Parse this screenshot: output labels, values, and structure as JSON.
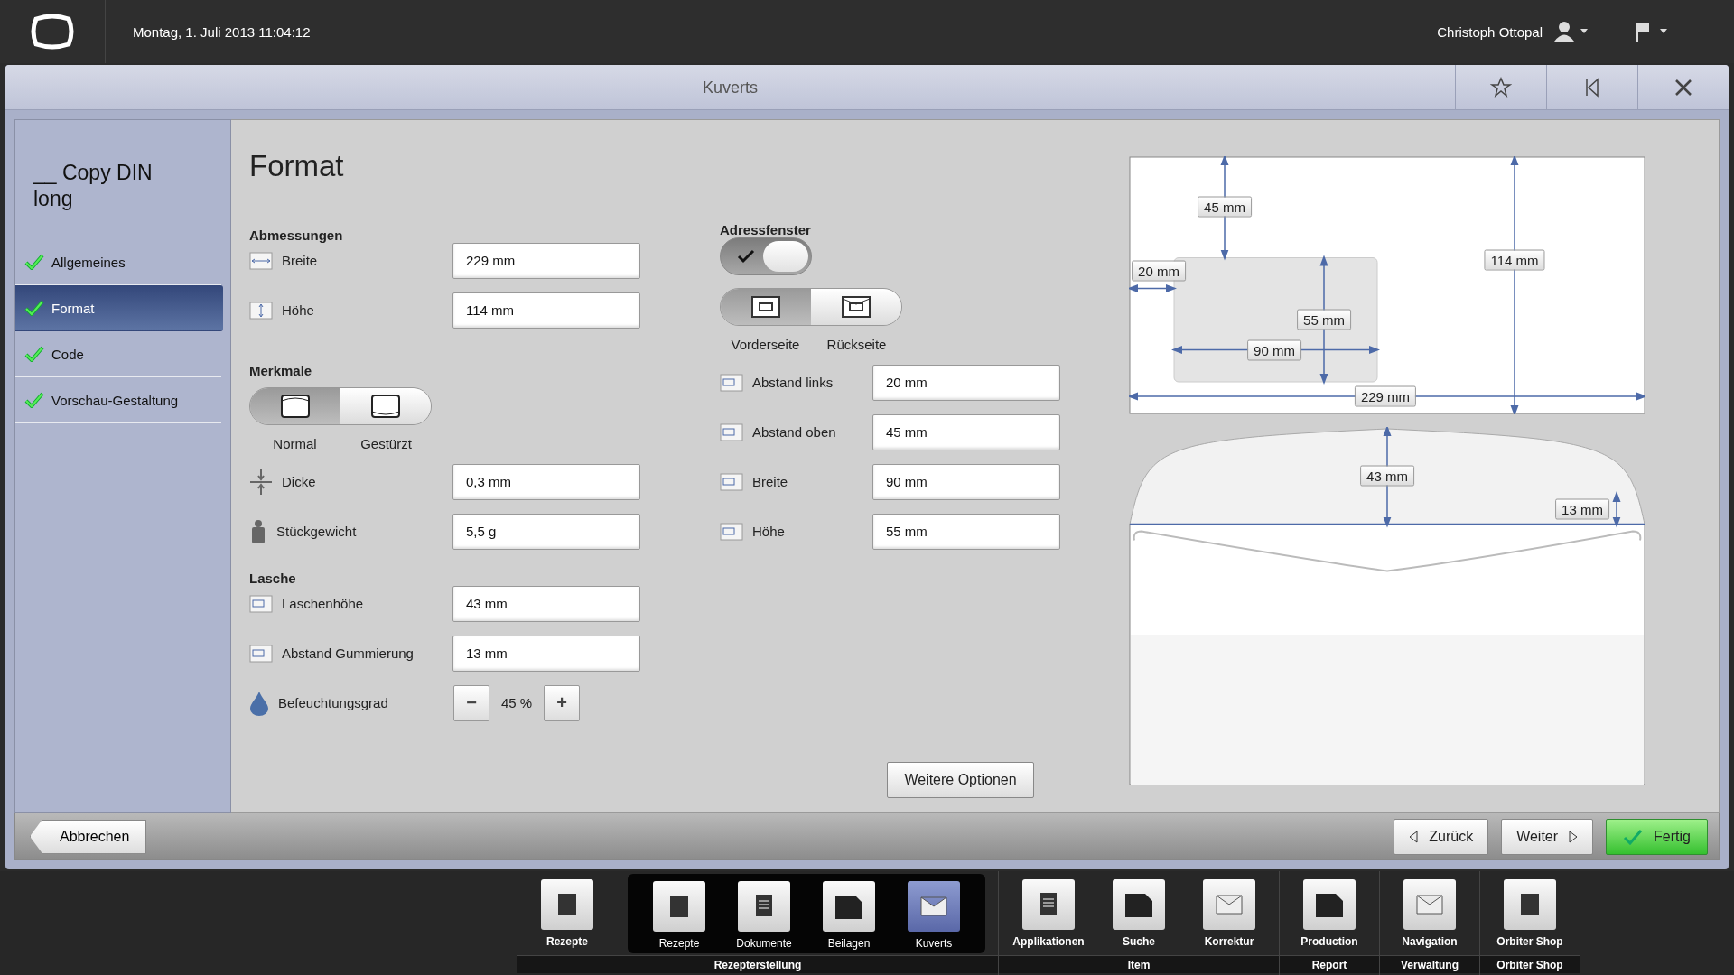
{
  "top_bar": {
    "datetime": "Montag, 1. Juli 2013 11:04:12",
    "user": "Christoph Ottopal"
  },
  "window": {
    "title": "Kuverts"
  },
  "sidebar": {
    "title": "__ Copy DIN long",
    "items": [
      {
        "label": "Allgemeines",
        "done": true,
        "selected": false
      },
      {
        "label": "Format",
        "done": true,
        "selected": true
      },
      {
        "label": "Code",
        "done": true,
        "selected": false
      },
      {
        "label": "Vorschau-Gestaltung",
        "done": true,
        "selected": false
      }
    ]
  },
  "form": {
    "title": "Format",
    "dimensions": {
      "heading": "Abmessungen",
      "fields": [
        {
          "label": "Breite",
          "value": "229 mm"
        },
        {
          "label": "Höhe",
          "value": "114 mm"
        }
      ]
    },
    "features": {
      "heading": "Merkmale",
      "options": [
        {
          "label": "Normal",
          "selected": true
        },
        {
          "label": "Gestürzt",
          "selected": false
        }
      ],
      "fields": [
        {
          "label": "Dicke",
          "value": "0,3 mm"
        },
        {
          "label": "Stückgewicht",
          "value": "5,5 g"
        }
      ]
    },
    "flap": {
      "heading": "Lasche",
      "fields": [
        {
          "label": "Laschenhöhe",
          "value": "43 mm"
        },
        {
          "label": "Abstand Gummierung",
          "value": "13 mm"
        }
      ],
      "moisture": {
        "label": "Befeuchtungsgrad",
        "minus": "−",
        "value": "45 %",
        "plus": "+"
      }
    },
    "address_window": {
      "heading": "Adressfenster",
      "on": true,
      "sides": [
        {
          "label": "Vorderseite",
          "selected": true
        },
        {
          "label": "Rückseite",
          "selected": false
        }
      ],
      "fields": [
        {
          "label": "Abstand links",
          "value": "20 mm"
        },
        {
          "label": "Abstand oben",
          "value": "45 mm"
        },
        {
          "label": "Breite",
          "value": "90 mm"
        },
        {
          "label": "Höhe",
          "value": "55 mm"
        }
      ]
    },
    "more_button": "Weitere Optionen"
  },
  "preview": {
    "front": {
      "top": "45 mm",
      "left": "20 mm",
      "height": "114 mm",
      "window_height": "55 mm",
      "window_width": "90 mm",
      "width": "229 mm"
    },
    "back": {
      "flap_height": "43 mm",
      "gum_distance": "13 mm"
    }
  },
  "footer": {
    "cancel": "Abbrechen",
    "back": "Zurück",
    "next": "Weiter",
    "finish": "Fertig"
  },
  "taskbar": {
    "groups": [
      {
        "label": "Rezepterstellung",
        "items": [
          {
            "label": "Rezepte",
            "selected": false
          }
        ],
        "submenu": [
          {
            "label": "Rezepte",
            "selected": false
          },
          {
            "label": "Dokumente",
            "selected": false
          },
          {
            "label": "Beilagen",
            "selected": false
          },
          {
            "label": "Kuverts",
            "selected": true
          }
        ]
      },
      {
        "label": "Item",
        "items": [
          {
            "label": "Applikationen",
            "selected": false
          },
          {
            "label": "Suche",
            "selected": false
          },
          {
            "label": "Korrektur",
            "selected": false
          }
        ]
      },
      {
        "label": "Report",
        "items": [
          {
            "label": "Production",
            "selected": false
          }
        ]
      },
      {
        "label": "Verwaltung",
        "items": [
          {
            "label": "Navigation",
            "selected": false
          }
        ]
      },
      {
        "label": "Orbiter Shop",
        "items": [
          {
            "label": "Orbiter Shop",
            "selected": false
          }
        ]
      }
    ]
  }
}
